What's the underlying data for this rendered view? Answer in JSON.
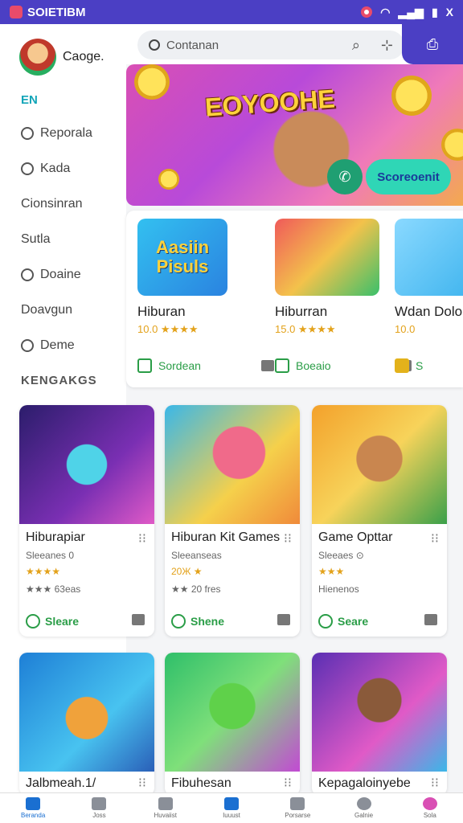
{
  "status": {
    "carrier": "SOIETIBM",
    "close": "X"
  },
  "profile": {
    "name": "Caoge."
  },
  "sidebar": {
    "tag": "EN",
    "items": [
      {
        "label": "Reporala",
        "icon": "clock-icon"
      },
      {
        "label": "Kada",
        "icon": "user-icon"
      },
      {
        "label": "Cionsinran",
        "icon": ""
      },
      {
        "label": "Sutla",
        "icon": ""
      },
      {
        "label": "Doaine",
        "icon": "person-icon"
      },
      {
        "label": "Doavgun",
        "icon": ""
      },
      {
        "label": "Deme",
        "icon": "user-icon"
      }
    ],
    "section": "KENGAKGS"
  },
  "search": {
    "placeholder": "Contanan"
  },
  "banner": {
    "title": "EOYOOHE",
    "cta": "Scoreoenit"
  },
  "featured": [
    {
      "name": "Hiburan",
      "rating": "10.0 ★★★★",
      "badge": "Sordean",
      "thumb_text": "Aasiin Pisuls"
    },
    {
      "name": "Hiburran",
      "rating": "15.0 ★★★★",
      "badge": "Boeaio"
    },
    {
      "name": "Wdan Dolo",
      "rating": "10.0",
      "badge": "S"
    }
  ],
  "grid": [
    {
      "title": "Hiburapiar",
      "sub": "Sleeanes 0",
      "stars": "★★★★",
      "count": "★★★ 63eas",
      "share": "Sleare"
    },
    {
      "title": "Hiburan Kit Games",
      "sub": "Sleeanseas",
      "stars": "20Ж ★",
      "count": "★★ 20 fres",
      "share": "Shene"
    },
    {
      "title": "Game Opttar",
      "sub": "Sleeaes ⊙",
      "stars": "★★★",
      "count": "Hienenos",
      "share": "Seare"
    }
  ],
  "grid2": [
    {
      "title": "Jalbmeah.1/"
    },
    {
      "title": "Fibuhesan"
    },
    {
      "title": "Kepagaloinyebe"
    }
  ],
  "nav": [
    {
      "label": "Beranda",
      "active": true
    },
    {
      "label": "Joss"
    },
    {
      "label": "Huvaiist"
    },
    {
      "label": "Iuuust"
    },
    {
      "label": "Porsarse"
    },
    {
      "label": "Galnie"
    },
    {
      "label": "Sola"
    }
  ]
}
